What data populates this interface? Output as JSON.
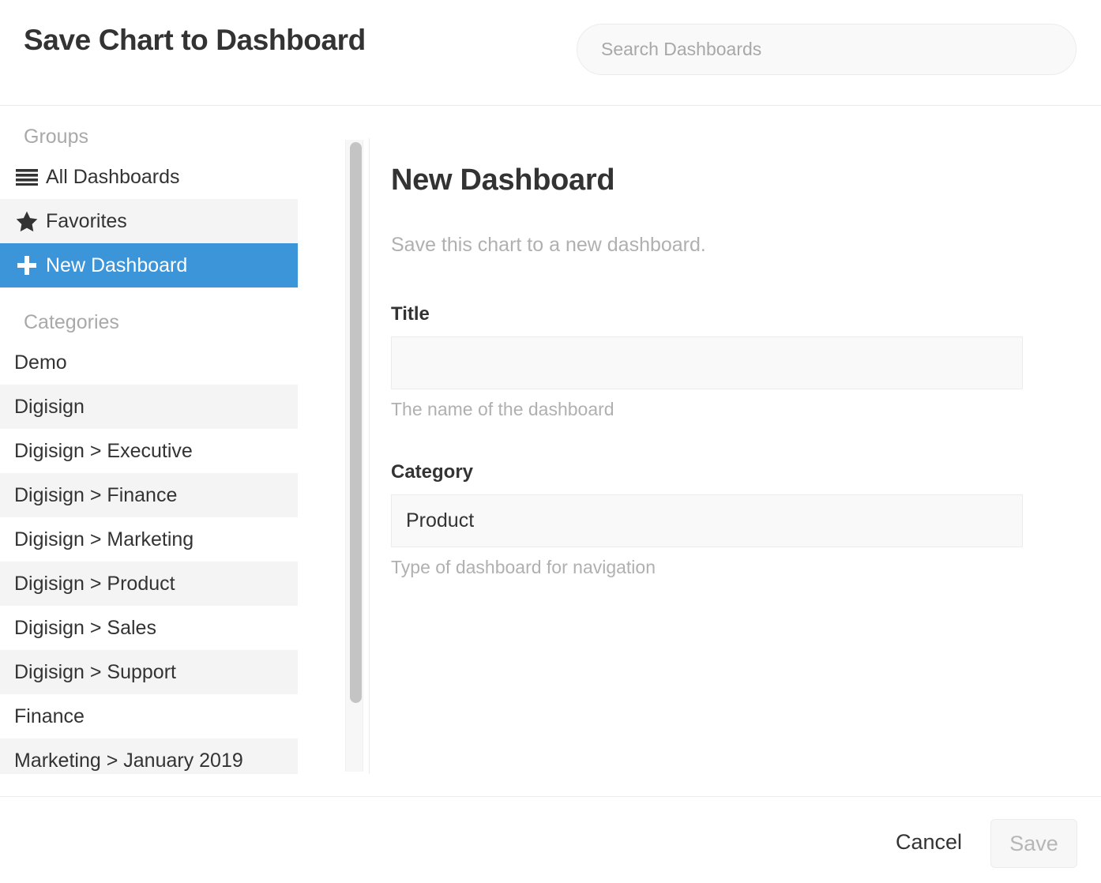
{
  "header": {
    "title": "Save Chart to Dashboard",
    "search": {
      "placeholder": "Search Dashboards",
      "value": ""
    }
  },
  "sidebar": {
    "groups_label": "Groups",
    "groups": [
      {
        "label": "All Dashboards",
        "icon": "list-icon",
        "state": "default"
      },
      {
        "label": "Favorites",
        "icon": "star-icon",
        "state": "alt"
      },
      {
        "label": "New Dashboard",
        "icon": "plus-icon",
        "state": "selected"
      }
    ],
    "categories_label": "Categories",
    "categories": [
      {
        "label": "Demo"
      },
      {
        "label": "Digisign"
      },
      {
        "label": "Digisign > Executive"
      },
      {
        "label": "Digisign > Finance"
      },
      {
        "label": "Digisign > Marketing"
      },
      {
        "label": "Digisign > Product"
      },
      {
        "label": "Digisign > Sales"
      },
      {
        "label": "Digisign > Support"
      },
      {
        "label": "Finance"
      },
      {
        "label": "Marketing > January 2019"
      }
    ]
  },
  "panel": {
    "title": "New Dashboard",
    "subtitle": "Save this chart to a new dashboard.",
    "fields": {
      "title": {
        "label": "Title",
        "value": "",
        "placeholder": "",
        "help": "The name of the dashboard"
      },
      "category": {
        "label": "Category",
        "value": "Product",
        "placeholder": "",
        "help": "Type of dashboard for navigation"
      }
    }
  },
  "footer": {
    "cancel_label": "Cancel",
    "save_label": "Save"
  },
  "colors": {
    "accent": "#3d95d9",
    "row_alt": "#f4f4f4",
    "muted_text": "#b0b0b0",
    "field_bg": "#f9f9f9"
  }
}
